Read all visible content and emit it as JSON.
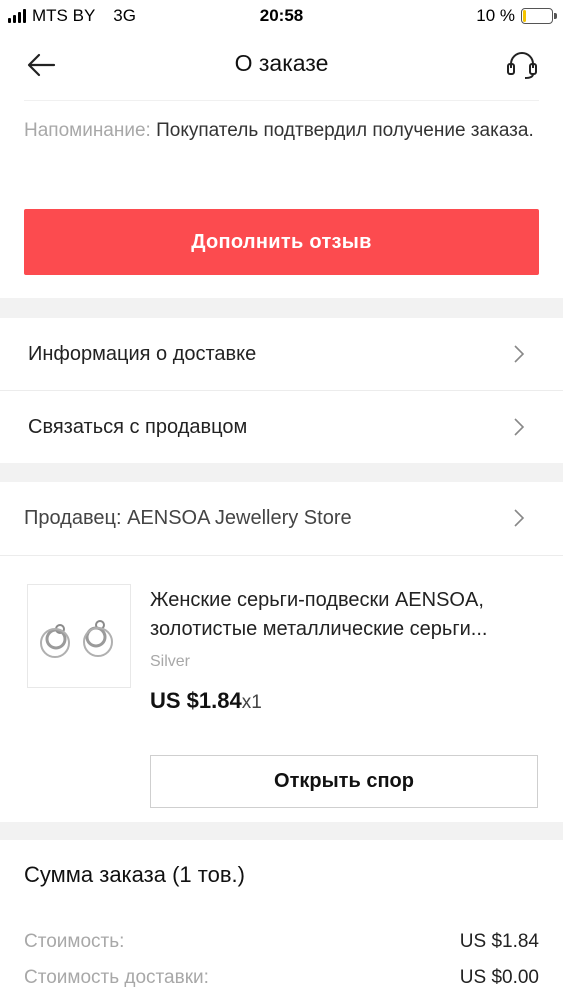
{
  "status_bar": {
    "carrier": "MTS BY",
    "network": "3G",
    "time": "20:58",
    "battery_text": "10 %",
    "battery_level": 0.1
  },
  "header": {
    "title": "О заказе"
  },
  "reminder": {
    "label": "Напоминание:",
    "text": " Покупатель подтвердил получение заказа."
  },
  "review_button": {
    "label": "Дополнить отзыв"
  },
  "menu": {
    "delivery_info": "Информация о доставке",
    "contact_seller": "Связаться с продавцом"
  },
  "seller": {
    "label": "Продавец: AENSOA Jewellery Store"
  },
  "product": {
    "title": "Женские серьги-подвески AENSOA, золотистые металлические серьги...",
    "variant": "Silver",
    "price": "US $1.84",
    "quantity": "x1"
  },
  "dispute_button": {
    "label": "Открыть спор"
  },
  "summary": {
    "title": "Сумма заказа (1 тов.)",
    "cost_label": "Стоимость:",
    "cost_value": "US $1.84",
    "shipping_label": "Стоимость доставки:",
    "shipping_value": "US $0.00"
  },
  "colors": {
    "accent": "#fc4b4f",
    "section_gap": "#f2f2f2",
    "muted_text": "#a8a8a8"
  }
}
